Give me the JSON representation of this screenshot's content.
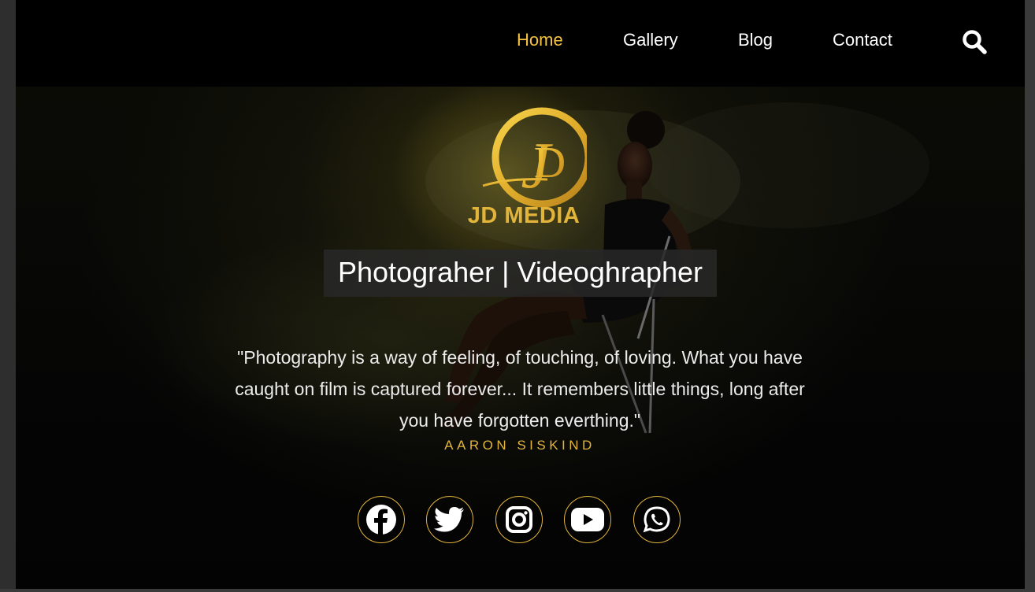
{
  "nav": {
    "items": [
      {
        "label": "Home",
        "active": true
      },
      {
        "label": "Gallery",
        "active": false
      },
      {
        "label": "Blog",
        "active": false
      },
      {
        "label": "Contact",
        "active": false
      }
    ],
    "search_icon": "search-icon"
  },
  "brand": {
    "name": "JD MEDIA",
    "logo_icon": "jd-monogram-logo"
  },
  "hero": {
    "tagline": "Photograher | Videoghrapher",
    "quote": "\"Photography is a way of feeling, of touching, of loving. What you have caught on film is captured forever... It remembers little things, long after you have forgotten everthing.\"",
    "author": "AARON SISKIND"
  },
  "socials": [
    {
      "icon": "facebook-icon"
    },
    {
      "icon": "twitter-icon"
    },
    {
      "icon": "instagram-icon"
    },
    {
      "icon": "youtube-icon"
    },
    {
      "icon": "whatsapp-icon"
    }
  ],
  "colors": {
    "accent": "#e2b53a",
    "nav_active": "#f5c242",
    "background": "#000000",
    "text": "#ffffff"
  }
}
